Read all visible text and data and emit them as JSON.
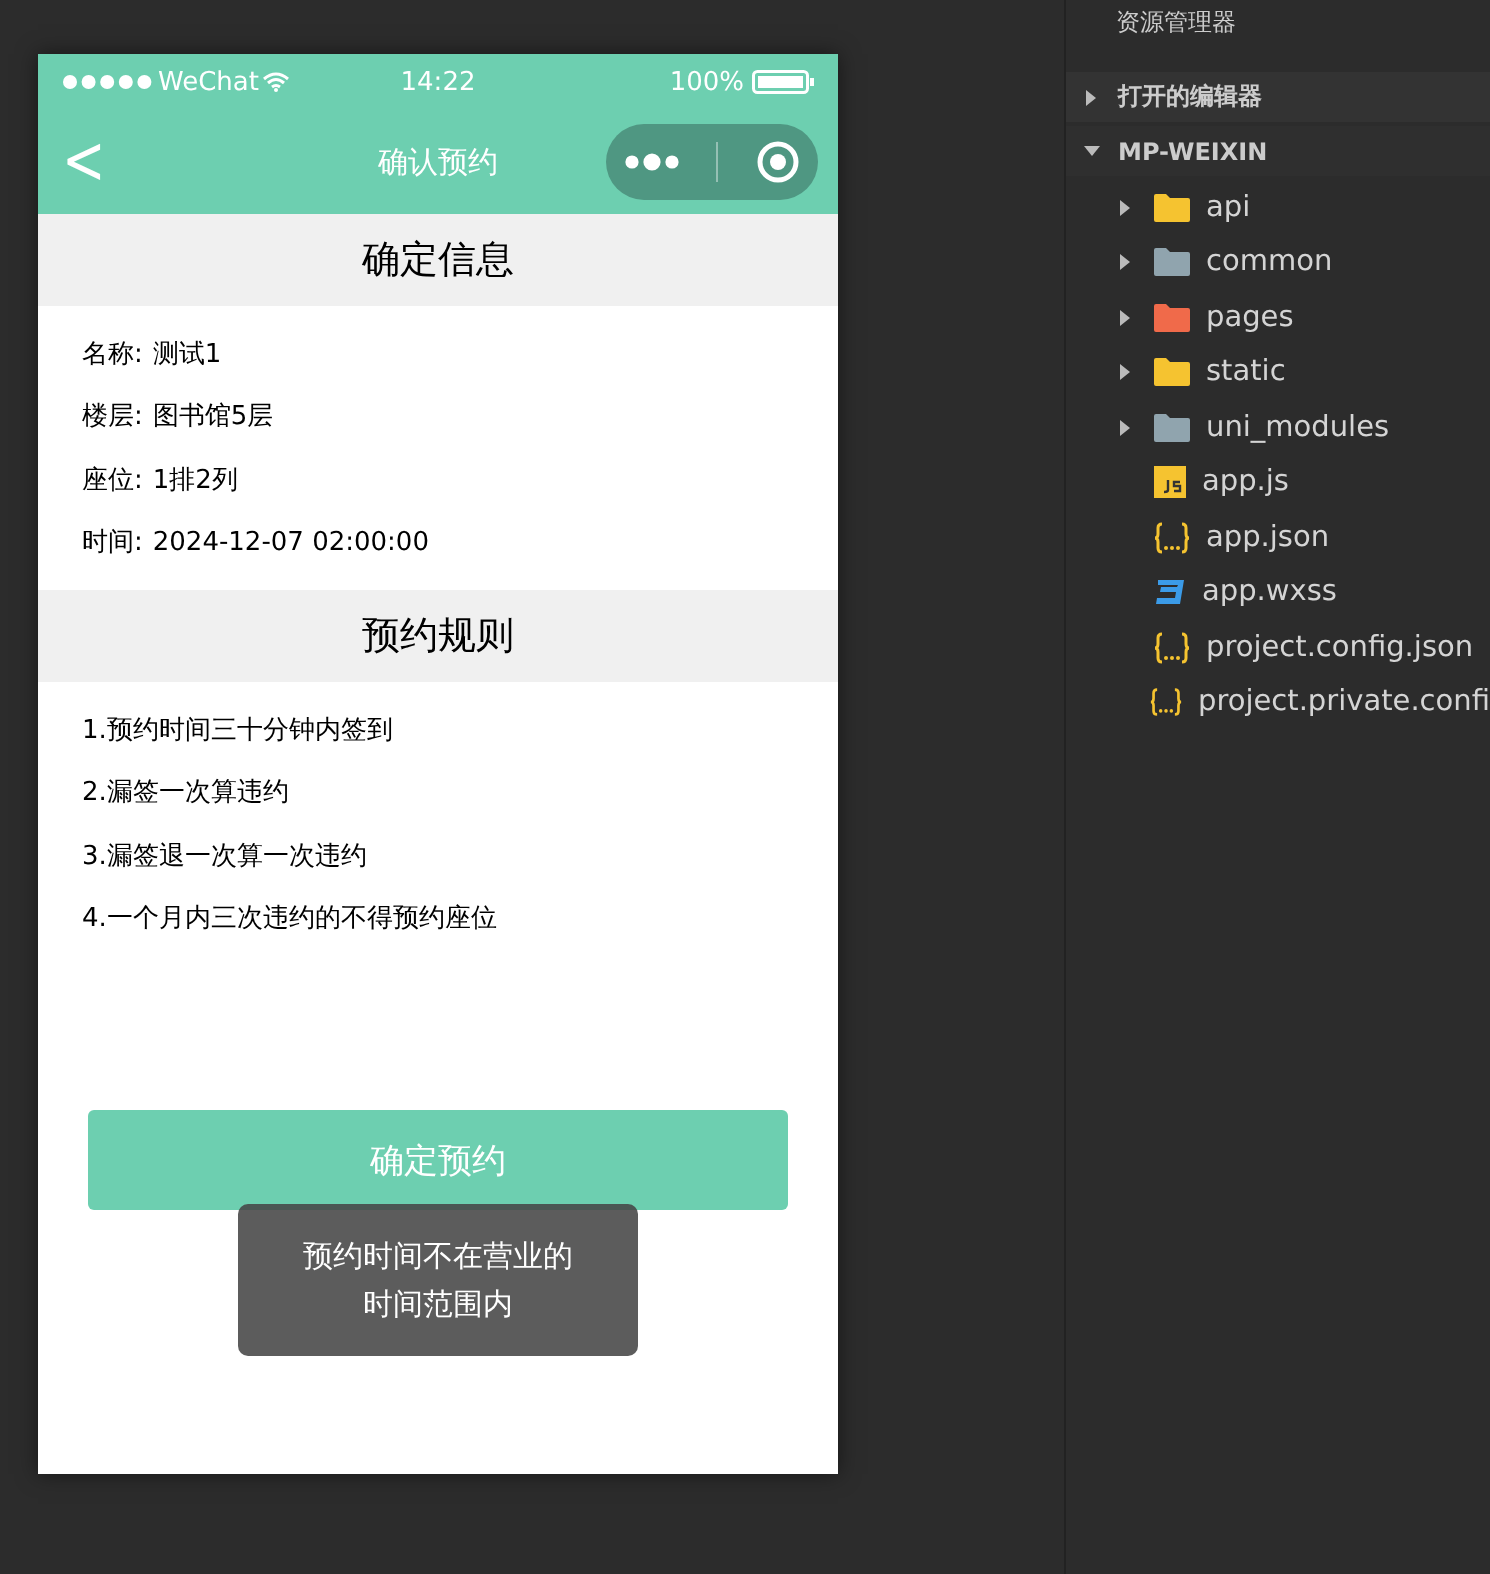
{
  "phone": {
    "status_bar": {
      "carrier": "WeChat",
      "time": "14:22",
      "battery": "100%"
    },
    "nav_bar": {
      "back": "<",
      "title": "确认预约"
    },
    "sections": [
      {
        "title": "确定信息",
        "lines": [
          {
            "label": "名称:",
            "value": "测试1"
          },
          {
            "label": "楼层:",
            "value": "图书馆5层"
          },
          {
            "label": "座位:",
            "value": "1排2列"
          },
          {
            "label": "时间:",
            "value": "2024-12-07 02:00:00"
          }
        ]
      },
      {
        "title": "预约规则",
        "lines": [
          {
            "value": "1.预约时间三十分钟内签到"
          },
          {
            "value": "2.漏签一次算违约"
          },
          {
            "value": "3.漏签退一次算一次违约"
          },
          {
            "value": "4.一个月内三次违约的不得预约座位"
          }
        ]
      }
    ],
    "confirm_button": "确定预约",
    "toast": "预约时间不在营业的时间范围内"
  },
  "explorer": {
    "title": "资源管理器",
    "sections": [
      {
        "title": "打开的编辑器",
        "expanded": false
      },
      {
        "title": "MP-WEIXIN",
        "expanded": true
      }
    ],
    "items": [
      {
        "kind": "folder",
        "name": "api",
        "color": "#f5c330",
        "expanded": false
      },
      {
        "kind": "folder",
        "name": "common",
        "color": "#90a4ae",
        "expanded": false
      },
      {
        "kind": "folder",
        "name": "pages",
        "color": "#f06a4a",
        "expanded": false
      },
      {
        "kind": "folder",
        "name": "static",
        "color": "#f5c330",
        "expanded": false
      },
      {
        "kind": "folder",
        "name": "uni_modules",
        "color": "#90a4ae",
        "expanded": false
      },
      {
        "kind": "js",
        "name": "app.js"
      },
      {
        "kind": "json",
        "name": "app.json"
      },
      {
        "kind": "css",
        "name": "app.wxss"
      },
      {
        "kind": "json",
        "name": "project.config.json"
      },
      {
        "kind": "json",
        "name": "project.private.confi"
      }
    ]
  }
}
